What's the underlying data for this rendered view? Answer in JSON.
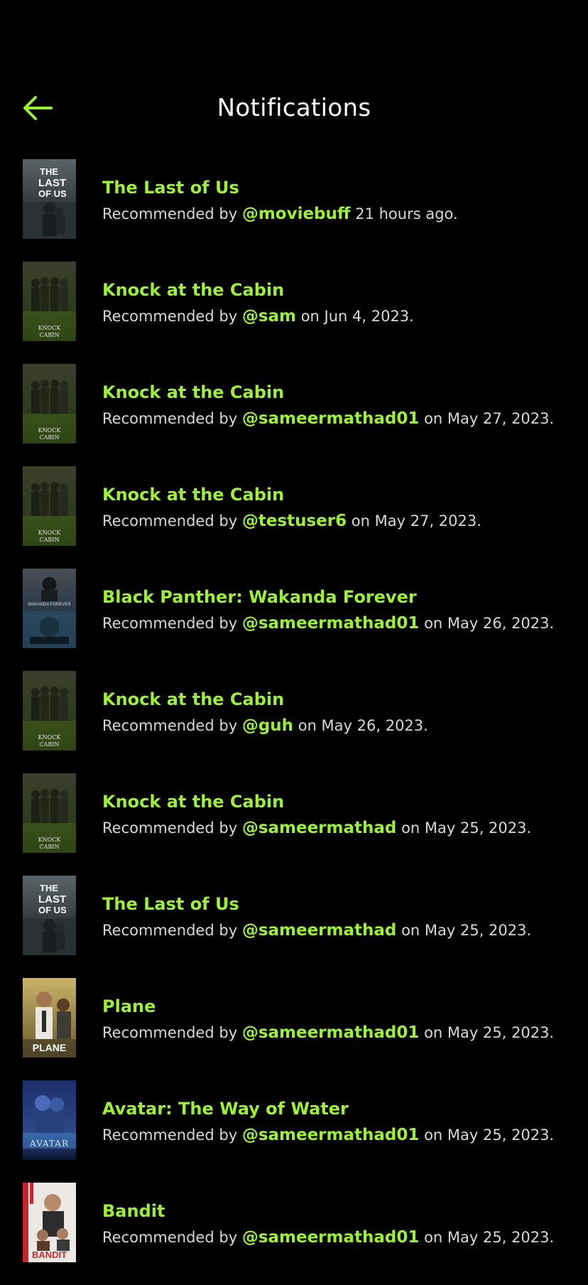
{
  "header": {
    "title": "Notifications",
    "back_icon": "arrow-left-icon",
    "accent": "#9cf035"
  },
  "notifications": [
    {
      "title": "The Last of Us",
      "prefix": "Recommended by",
      "user": "@moviebuff",
      "suffix": "21 hours ago.",
      "poster": "tlou"
    },
    {
      "title": "Knock at the Cabin",
      "prefix": "Recommended by",
      "user": "@sam",
      "suffix": "on Jun 4, 2023.",
      "poster": "cabin"
    },
    {
      "title": "Knock at the Cabin",
      "prefix": "Recommended by",
      "user": "@sameermathad01",
      "suffix": "on May 27, 2023.",
      "poster": "cabin"
    },
    {
      "title": "Knock at the Cabin",
      "prefix": "Recommended by",
      "user": "@testuser6",
      "suffix": "on May 27, 2023.",
      "poster": "cabin"
    },
    {
      "title": "Black Panther: Wakanda Forever",
      "prefix": "Recommended by",
      "user": "@sameermathad01",
      "suffix": "on May 26, 2023.",
      "poster": "panther"
    },
    {
      "title": "Knock at the Cabin",
      "prefix": "Recommended by",
      "user": "@guh",
      "suffix": "on May 26, 2023.",
      "poster": "cabin"
    },
    {
      "title": "Knock at the Cabin",
      "prefix": "Recommended by",
      "user": "@sameermathad",
      "suffix": "on May 25, 2023.",
      "poster": "cabin"
    },
    {
      "title": "The Last of Us",
      "prefix": "Recommended by",
      "user": "@sameermathad",
      "suffix": "on May 25, 2023.",
      "poster": "tlou"
    },
    {
      "title": "Plane",
      "prefix": "Recommended by",
      "user": "@sameermathad01",
      "suffix": "on May 25, 2023.",
      "poster": "plane"
    },
    {
      "title": "Avatar: The Way of Water",
      "prefix": "Recommended by",
      "user": "@sameermathad01",
      "suffix": "on May 25, 2023.",
      "poster": "avatar"
    },
    {
      "title": "Bandit",
      "prefix": "Recommended by",
      "user": "@sameermathad01",
      "suffix": "on May 25, 2023.",
      "poster": "bandit"
    }
  ],
  "posters": {
    "tlou": {
      "text": "THE LAST OF US"
    },
    "cabin": {
      "text": "KNOCK AT THE CABIN"
    },
    "panther": {
      "text": "WAKANDA FOREVER"
    },
    "plane": {
      "text": "PLANE"
    },
    "avatar": {
      "text": "AVATAR"
    },
    "bandit": {
      "text": "BANDIT"
    }
  }
}
